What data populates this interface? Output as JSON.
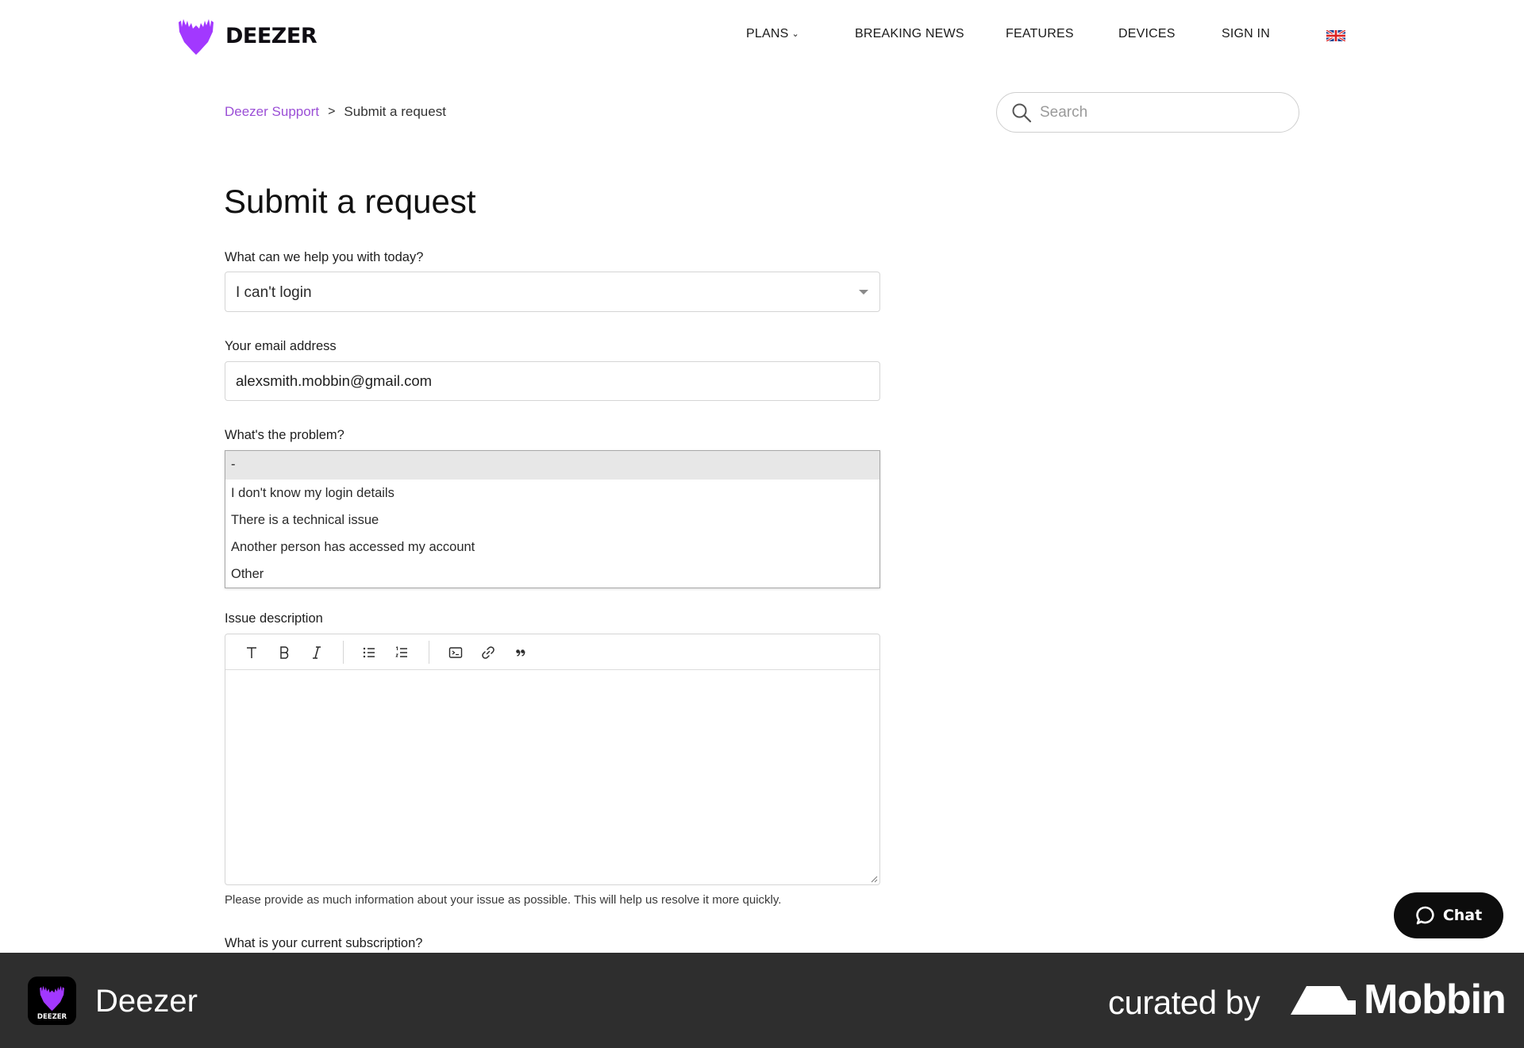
{
  "brand": {
    "name": "DEEZER",
    "accent": "#a238ff"
  },
  "nav": {
    "plans": "PLANS",
    "breaking_news": "BREAKING NEWS",
    "features": "FEATURES",
    "devices": "DEVICES",
    "sign_in": "SIGN IN",
    "language_icon": "uk-flag-icon"
  },
  "breadcrumb": {
    "root": "Deezer Support",
    "separator": ">",
    "current": "Submit a request"
  },
  "search": {
    "placeholder": "Search",
    "value": ""
  },
  "form": {
    "title": "Submit a request",
    "help_label": "What can we help you with today?",
    "help_value": "I can't login",
    "email_label": "Your email address",
    "email_value": "alexsmith.mobbin@gmail.com",
    "problem_label": "What's the problem?",
    "problem_options": [
      "-",
      "I don't know my login details",
      "There is a technical issue",
      "Another person has accessed my account",
      "Other"
    ],
    "problem_selected_index": 0,
    "description_label": "Issue description",
    "toolbar_icons": [
      "text-format-icon",
      "bold-icon",
      "italic-icon",
      "bulleted-list-icon",
      "numbered-list-icon",
      "code-block-icon",
      "link-icon",
      "quote-icon"
    ],
    "description_hint": "Please provide as much information about your issue as possible. This will help us resolve it more quickly.",
    "subscription_label": "What is your current subscription?"
  },
  "chat": {
    "label": "Chat"
  },
  "footer": {
    "app_name": "Deezer",
    "app_icon_text": "DEEZER",
    "curated_by": "curated by",
    "curator": "Mobbin"
  }
}
